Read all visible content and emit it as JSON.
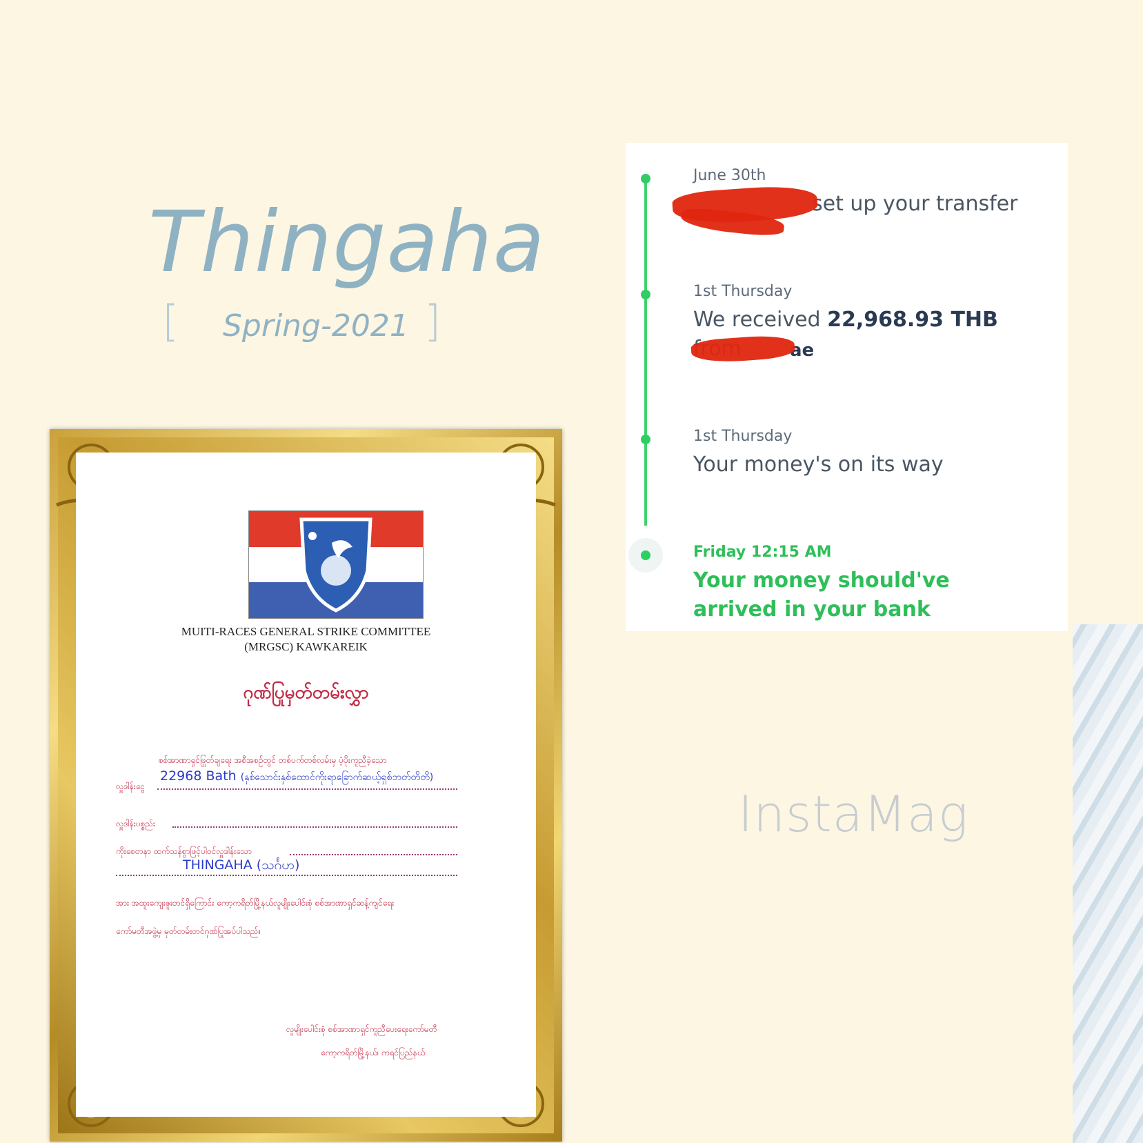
{
  "title": "Thingaha",
  "subtitle": "Spring-2021",
  "bracket_left": "[",
  "bracket_right": "]",
  "transfer": {
    "steps": [
      {
        "date": "June 30th",
        "text": "set up your transfer"
      },
      {
        "date": "1st Thursday",
        "text_prefix": "We received ",
        "amount": "22,968.93 THB",
        "text_suffix": " from",
        "line2": "ae"
      },
      {
        "date": "1st Thursday",
        "text": "Your money's on its way"
      },
      {
        "date": "Friday 12:15 AM",
        "text": "Your money should've arrived in your bank"
      }
    ]
  },
  "certificate": {
    "org_line1": "MUITI-RACES GENERAL STRIKE COMMITTEE",
    "org_line2": "(MRGSC) KAWKAREIK",
    "title": "ဂုဏ်ပြုမှတ်တမ်းလွှာ",
    "line1": "စစ်အာဏာရှင်ဖြုတ်ချရေး အစီအစဉ်တွင် တစ်ပက်တစ်လမ်းမှ ပံ့ပိုးကူညီခဲ့သော",
    "label_amount": "လှူဒါန်းငွေ",
    "amount_value": "22968 Bath",
    "amount_words": "(နှစ်သောင်းနှစ်ထောင်ကိုးရာခြောက်ဆယ့်ရှစ်ဘတ်တိတိ)",
    "label_item": "လှူဒါန်းပစ္စည်း",
    "label_donor": "ကိုးစေတနာ ထက်သန်စွာဖြင့်ပါဝင်လှူဒါန်းသော",
    "donor_value": "THINGAHA",
    "donor_mm": "(သင်္ဂဟ)",
    "line_thanks": "အား အထူးကျေးဇူးတင်ရှိကြောင်း ကော့ကရိတ်မြို့နယ်လူမျိုးပေါင်းစုံ စစ်အာဏာရှင်ဆန့်ကျင်ရေး",
    "line_thanks2": "ကော်မတီအဖွဲ့မှ မှတ်တမ်းတင်ဂုဏ်ပြုအပ်ပါသည်။",
    "sign1": "လူမျိုးပေါင်းစုံ စစ်အာဏာရှင်ကူညီပေးရေးကော်မတီ",
    "sign2": "ကော့ကရိတ်မြို့နယ်၊ ကရင်ပြည်နယ်"
  },
  "watermark": "InstaMag",
  "colors": {
    "background": "#fdf6e3",
    "title": "#8fb2c3",
    "timeline_green": "#2fce64",
    "certificate_red": "#c22b45",
    "filled_blue": "#2a3ac9"
  }
}
